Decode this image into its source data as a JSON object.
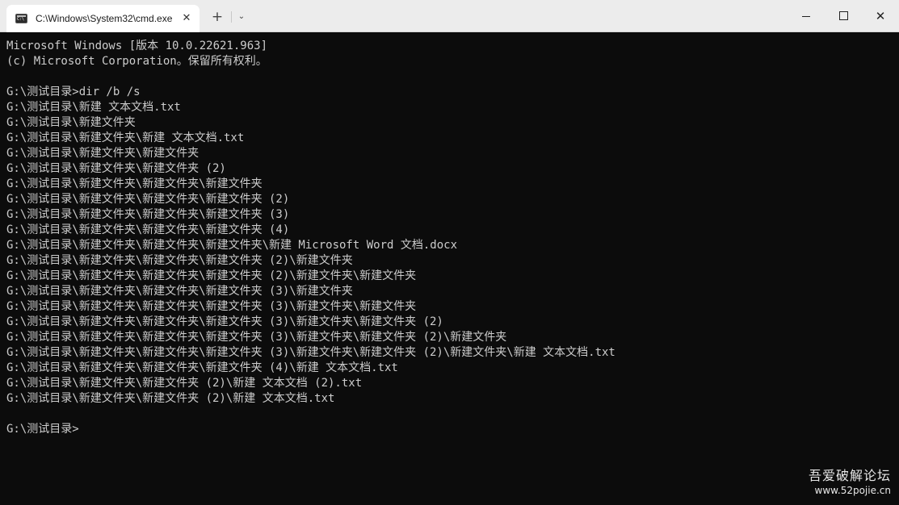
{
  "titlebar": {
    "tab_title": "C:\\Windows\\System32\\cmd.exe",
    "tab_close_glyph": "✕",
    "new_tab_glyph": "+",
    "dropdown_glyph": "⌄",
    "close_glyph": "✕",
    "icons": {
      "tab": "cmd-icon",
      "new_tab": "plus-icon",
      "dropdown": "chevron-down-icon",
      "minimize": "minimize-icon",
      "maximize": "maximize-icon",
      "close": "close-icon"
    }
  },
  "terminal": {
    "text_color": "#cccccc",
    "background": "#0c0c0c",
    "lines": [
      "Microsoft Windows [版本 10.0.22621.963]",
      "(c) Microsoft Corporation。保留所有权利。",
      "",
      "G:\\测试目录>dir /b /s",
      "G:\\测试目录\\新建 文本文档.txt",
      "G:\\测试目录\\新建文件夹",
      "G:\\测试目录\\新建文件夹\\新建 文本文档.txt",
      "G:\\测试目录\\新建文件夹\\新建文件夹",
      "G:\\测试目录\\新建文件夹\\新建文件夹 (2)",
      "G:\\测试目录\\新建文件夹\\新建文件夹\\新建文件夹",
      "G:\\测试目录\\新建文件夹\\新建文件夹\\新建文件夹 (2)",
      "G:\\测试目录\\新建文件夹\\新建文件夹\\新建文件夹 (3)",
      "G:\\测试目录\\新建文件夹\\新建文件夹\\新建文件夹 (4)",
      "G:\\测试目录\\新建文件夹\\新建文件夹\\新建文件夹\\新建 Microsoft Word 文档.docx",
      "G:\\测试目录\\新建文件夹\\新建文件夹\\新建文件夹 (2)\\新建文件夹",
      "G:\\测试目录\\新建文件夹\\新建文件夹\\新建文件夹 (2)\\新建文件夹\\新建文件夹",
      "G:\\测试目录\\新建文件夹\\新建文件夹\\新建文件夹 (3)\\新建文件夹",
      "G:\\测试目录\\新建文件夹\\新建文件夹\\新建文件夹 (3)\\新建文件夹\\新建文件夹",
      "G:\\测试目录\\新建文件夹\\新建文件夹\\新建文件夹 (3)\\新建文件夹\\新建文件夹 (2)",
      "G:\\测试目录\\新建文件夹\\新建文件夹\\新建文件夹 (3)\\新建文件夹\\新建文件夹 (2)\\新建文件夹",
      "G:\\测试目录\\新建文件夹\\新建文件夹\\新建文件夹 (3)\\新建文件夹\\新建文件夹 (2)\\新建文件夹\\新建 文本文档.txt",
      "G:\\测试目录\\新建文件夹\\新建文件夹\\新建文件夹 (4)\\新建 文本文档.txt",
      "G:\\测试目录\\新建文件夹\\新建文件夹 (2)\\新建 文本文档 (2).txt",
      "G:\\测试目录\\新建文件夹\\新建文件夹 (2)\\新建 文本文档.txt",
      ""
    ],
    "prompt": "G:\\测试目录>"
  },
  "watermark": {
    "name": "吾爱破解论坛",
    "url": "www.52pojie.cn"
  }
}
